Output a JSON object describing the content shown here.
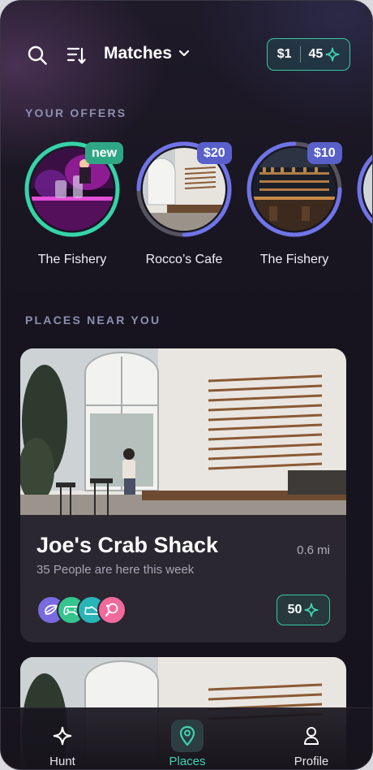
{
  "header": {
    "filter_label": "Matches",
    "wallet": {
      "cash": "$1",
      "points": "45"
    }
  },
  "offers": {
    "section_title": "YOUR OFFERS",
    "items": [
      {
        "name": "The Fishery",
        "badge": "new",
        "ring_color": "#36d3a9"
      },
      {
        "name": "Rocco’s Cafe",
        "badge": "$20",
        "ring_color": "#6f74e8"
      },
      {
        "name": "The Fishery",
        "badge": "$10",
        "ring_color": "#6f74e8"
      }
    ]
  },
  "places": {
    "section_title": "PLACES NEAR YOU",
    "cards": [
      {
        "name": "Joe's Crab Shack",
        "distance": "0.6 mi",
        "people": "35 People are here this week",
        "points": "50",
        "avatar_icons": [
          "mussel-icon",
          "gamepad-icon",
          "sneaker-icon",
          "ping-pong-icon"
        ]
      }
    ]
  },
  "tabbar": {
    "tabs": [
      {
        "label": "Hunt",
        "icon": "sparkle-icon"
      },
      {
        "label": "Places",
        "icon": "map-pin-icon",
        "active": true
      },
      {
        "label": "Profile",
        "icon": "person-icon"
      }
    ]
  },
  "colors": {
    "accent": "#36c9a1",
    "offer_accent": "#6f74e8",
    "section_label": "#8e8fb2"
  }
}
